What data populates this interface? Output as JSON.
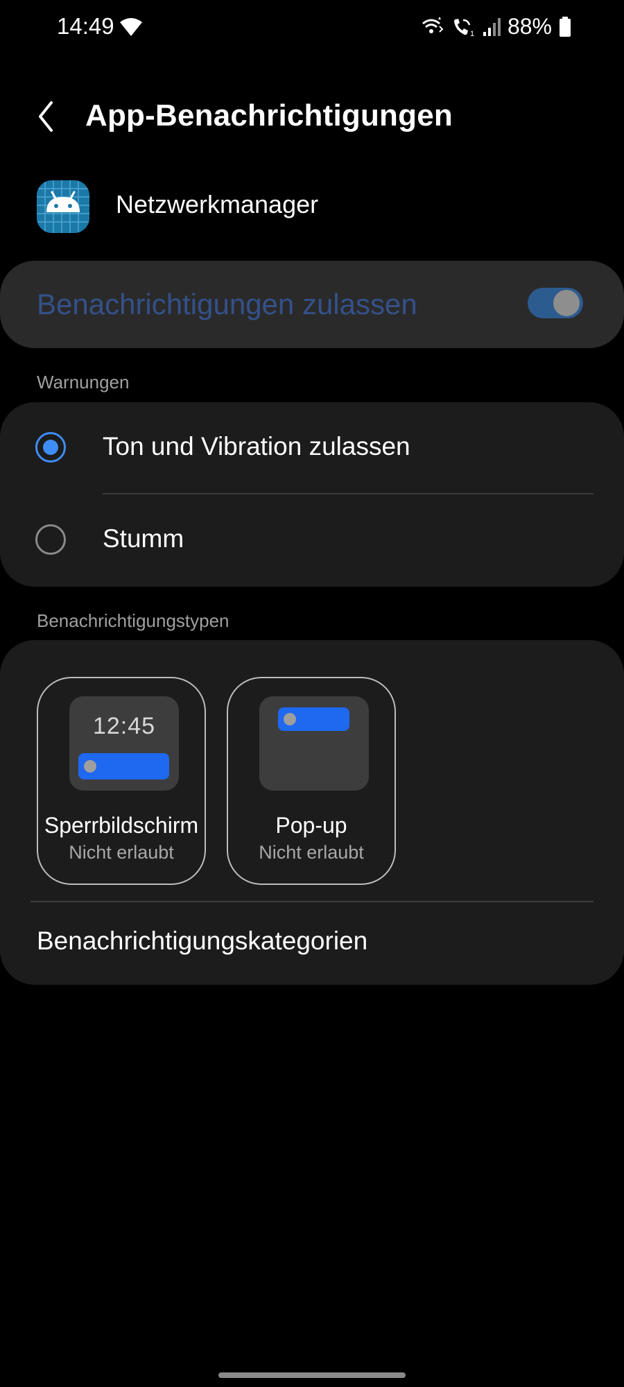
{
  "status_bar": {
    "time": "14:49",
    "battery_percent": "88%",
    "icons": [
      "wifi-icon",
      "wifi-calling-icon",
      "volte-call-icon",
      "signal-strength-icon",
      "battery-icon"
    ]
  },
  "header": {
    "title": "App-Benachrichtigungen",
    "back_icon": "chevron-left-icon"
  },
  "app": {
    "name": "Netzwerkmanager",
    "icon": "android-app-icon"
  },
  "master_toggle": {
    "label": "Benachrichtigungen zulassen",
    "enabled": true
  },
  "warnings": {
    "section_label": "Warnungen",
    "options": [
      {
        "label": "Ton und Vibration zulassen",
        "selected": true
      },
      {
        "label": "Stumm",
        "selected": false
      }
    ]
  },
  "types": {
    "section_label": "Benachrichtigungstypen",
    "tiles": [
      {
        "title": "Sperrbildschirm",
        "status": "Nicht erlaubt",
        "preview_time": "12:45"
      },
      {
        "title": "Pop-up",
        "status": "Nicht erlaubt"
      }
    ],
    "categories_label": "Benachrichtigungskategorien"
  },
  "colors": {
    "background": "#000000",
    "card": "#1c1c1c",
    "accent": "#3e8df7",
    "preview_bar": "#1f68f0",
    "master_label": "#34518a"
  }
}
